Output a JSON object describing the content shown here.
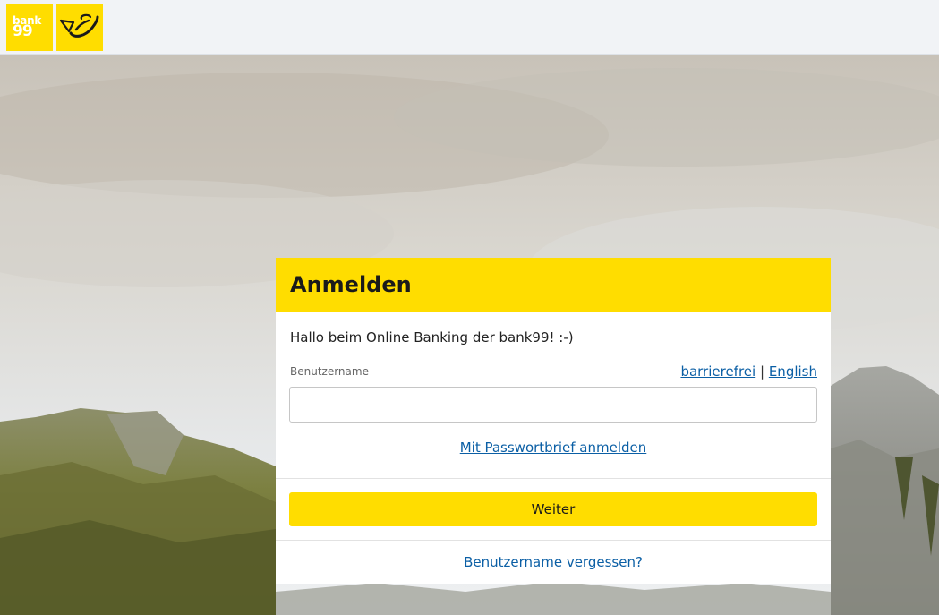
{
  "header": {
    "bank_logo_line1": "bank",
    "bank_logo_line2": "99"
  },
  "login": {
    "title": "Anmelden",
    "greeting": "Hallo beim Online Banking der bank99! :-)",
    "username_label": "Benutzername",
    "username_value": "",
    "lang_barrierefrei": "barrierefrei",
    "lang_separator": "|",
    "lang_english": "English",
    "password_letter_link": "Mit Passwortbrief anmelden",
    "continue_button": "Weiter",
    "forgot_username_link": "Benutzername vergessen?"
  },
  "colors": {
    "brand_yellow": "#ffdd00",
    "link_blue": "#0b5fa5",
    "header_bg": "#f1f3f6"
  },
  "icons": {
    "post_logo": "post-horn-icon",
    "background": "mountain-landscape-image"
  }
}
